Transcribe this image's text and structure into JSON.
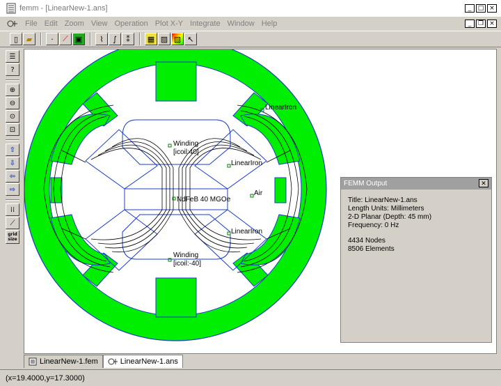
{
  "window": {
    "title": "femm - [LinearNew-1.ans]"
  },
  "menu": [
    "File",
    "Edit",
    "Zoom",
    "View",
    "Operation",
    "Plot X-Y",
    "Integrate",
    "Window",
    "Help"
  ],
  "toolbar": {
    "icons": [
      "new-file-icon",
      "open-file-icon",
      "point-mode-icon",
      "line-mode-icon",
      "block-mode-icon",
      "contour-plot-icon",
      "integral-icon",
      "density-plot-icon",
      "grid-toggle-icon",
      "hatch-icon",
      "color-plot-icon",
      "pointer-icon"
    ]
  },
  "left_toolbar": {
    "grid_label": "grid size"
  },
  "canvas": {
    "labels": {
      "winding_top_1": "Winding",
      "winding_top_2": "[icoil:40]",
      "winding_bot_1": "Winding",
      "winding_bot_2": "[icoil:-40]",
      "iron_top_right": "LinearIron",
      "iron_mid_upper": "LinearIron",
      "iron_mid_lower": "LinearIron",
      "magnet": "NdFeB 40 MGOe",
      "air": "Air"
    },
    "colors": {
      "iron": "#00ee00",
      "outline": "#1a3cc8",
      "flux": "#000000"
    }
  },
  "output": {
    "title": "FEMM Output",
    "close": "✕",
    "lines": [
      "Title: LinearNew-1.ans",
      "Length Units: Millimeters",
      "2-D Planar (Depth: 45 mm)",
      "Frequency: 0 Hz"
    ],
    "lines2": [
      "4434 Nodes",
      "8506 Elements"
    ]
  },
  "tabs": [
    {
      "label": "LinearNew-1.fem"
    },
    {
      "label": "LinearNew-1.ans"
    }
  ],
  "status": {
    "coords": "(x=19.4000,y=17.3000)"
  }
}
